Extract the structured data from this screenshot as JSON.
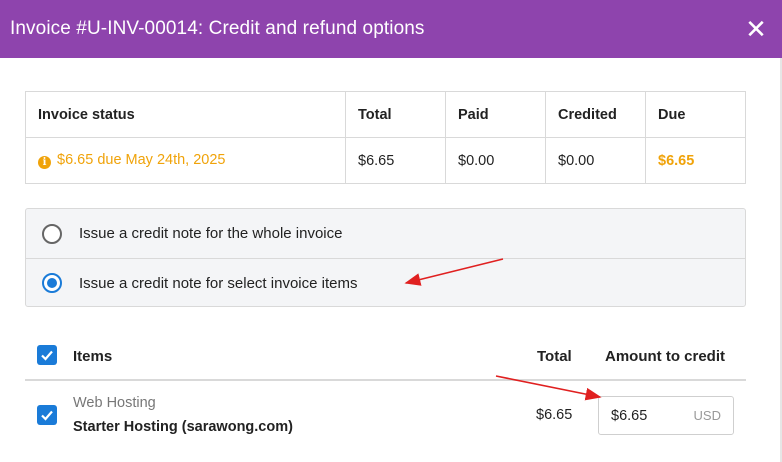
{
  "dialog": {
    "title": "Invoice #U-INV-00014: Credit and refund options",
    "close_icon": "close-icon",
    "accent_color": "#8e44ad"
  },
  "status_table": {
    "headers": [
      "Invoice status",
      "Total",
      "Paid",
      "Credited",
      "Due"
    ],
    "status_text": "$6.65 due May 24th, 2025",
    "total": "$6.65",
    "paid": "$0.00",
    "credited": "$0.00",
    "due": "$6.65",
    "status_color": "#f0a30a"
  },
  "options": [
    {
      "label": "Issue a credit note for the whole invoice",
      "selected": false
    },
    {
      "label": "Issue a credit note for select invoice items",
      "selected": true
    }
  ],
  "items_table": {
    "headers": {
      "items": "Items",
      "total": "Total",
      "amount": "Amount to credit"
    },
    "rows": [
      {
        "category": "Web Hosting",
        "name": "Starter Hosting (sarawong.com)",
        "total": "$6.65",
        "amount": "$6.65",
        "currency": "USD",
        "checked": true
      }
    ]
  },
  "annotation_color": "#e02020"
}
